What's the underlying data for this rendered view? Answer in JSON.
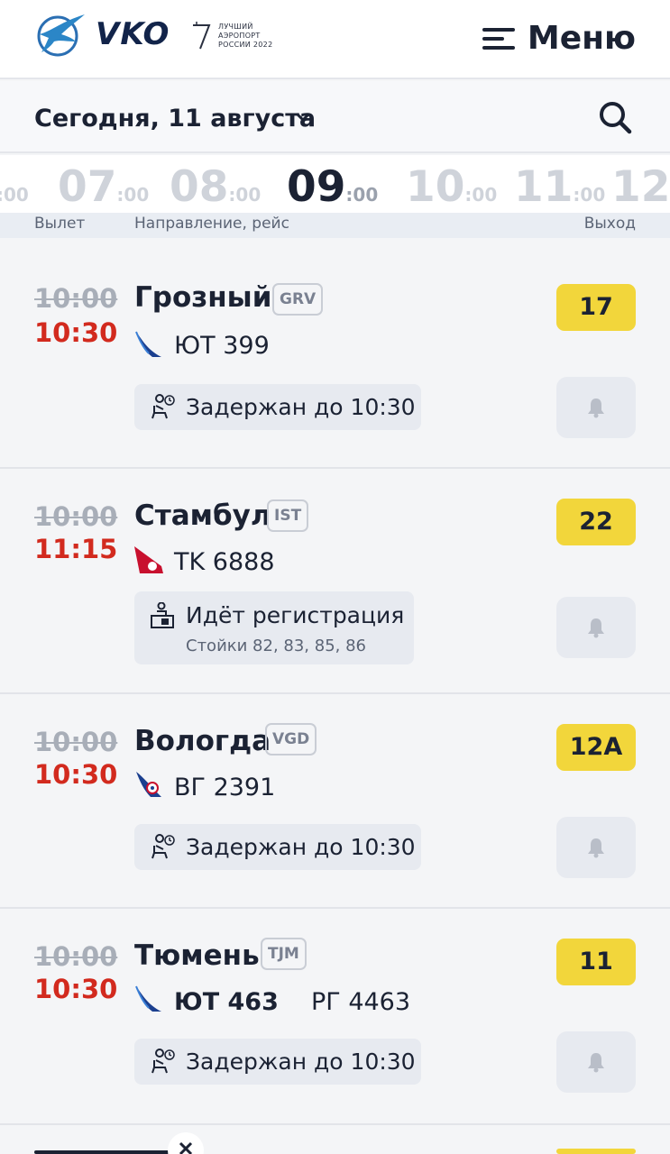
{
  "header": {
    "logo_text": "VKO",
    "award_lines": [
      "ЛУЧШИЙ",
      "АЭРОПОРТ",
      "РОССИИ 2022"
    ],
    "menu_label": "Меню"
  },
  "datebar": {
    "date_label": "Сегодня, 11 августа"
  },
  "timeline": {
    "hours": [
      {
        "h": "",
        "m": ":00"
      },
      {
        "h": "07",
        "m": ":00"
      },
      {
        "h": "08",
        "m": ":00"
      },
      {
        "h": "09",
        "m": ":00"
      },
      {
        "h": "10",
        "m": ":00"
      },
      {
        "h": "11",
        "m": ":00"
      },
      {
        "h": "12",
        "m": ""
      }
    ],
    "current_index": 3
  },
  "columns": {
    "departure": "Вылет",
    "destination": "Направление, рейс",
    "gate": "Выход"
  },
  "flights": [
    {
      "scheduled": "10:00",
      "actual": "10:30",
      "city": "Грозный",
      "code": "GRV",
      "airline_icon": "utair-icon",
      "flight_numbers": [
        "ЮТ 399"
      ],
      "gate": "17",
      "status": "Задержан до 10:30",
      "status_icon": "waiting-passenger-icon",
      "status_sub": ""
    },
    {
      "scheduled": "10:00",
      "actual": "11:15",
      "city": "Стамбул",
      "code": "IST",
      "airline_icon": "turkish-airlines-icon",
      "flight_numbers": [
        "TK 6888"
      ],
      "gate": "22",
      "status": "Идёт регистрация",
      "status_icon": "checkin-desk-icon",
      "status_sub": "Стойки 82, 83, 85, 86"
    },
    {
      "scheduled": "10:00",
      "actual": "10:30",
      "city": "Вологда",
      "code": "VGD",
      "airline_icon": "vologda-avia-icon",
      "flight_numbers": [
        "ВГ 2391"
      ],
      "gate": "12A",
      "status": "Задержан до 10:30",
      "status_icon": "waiting-passenger-icon",
      "status_sub": ""
    },
    {
      "scheduled": "10:00",
      "actual": "10:30",
      "city": "Тюмень",
      "code": "TJM",
      "airline_icon": "utair-icon",
      "flight_numbers": [
        "ЮТ 463",
        "РГ 4463"
      ],
      "gate": "11",
      "status": "Задержан до 10:30",
      "status_icon": "waiting-passenger-icon",
      "status_sub": ""
    }
  ],
  "colors": {
    "delay_red": "#d22a1e",
    "gate_yellow": "#f2d63b",
    "navy": "#12244a"
  }
}
